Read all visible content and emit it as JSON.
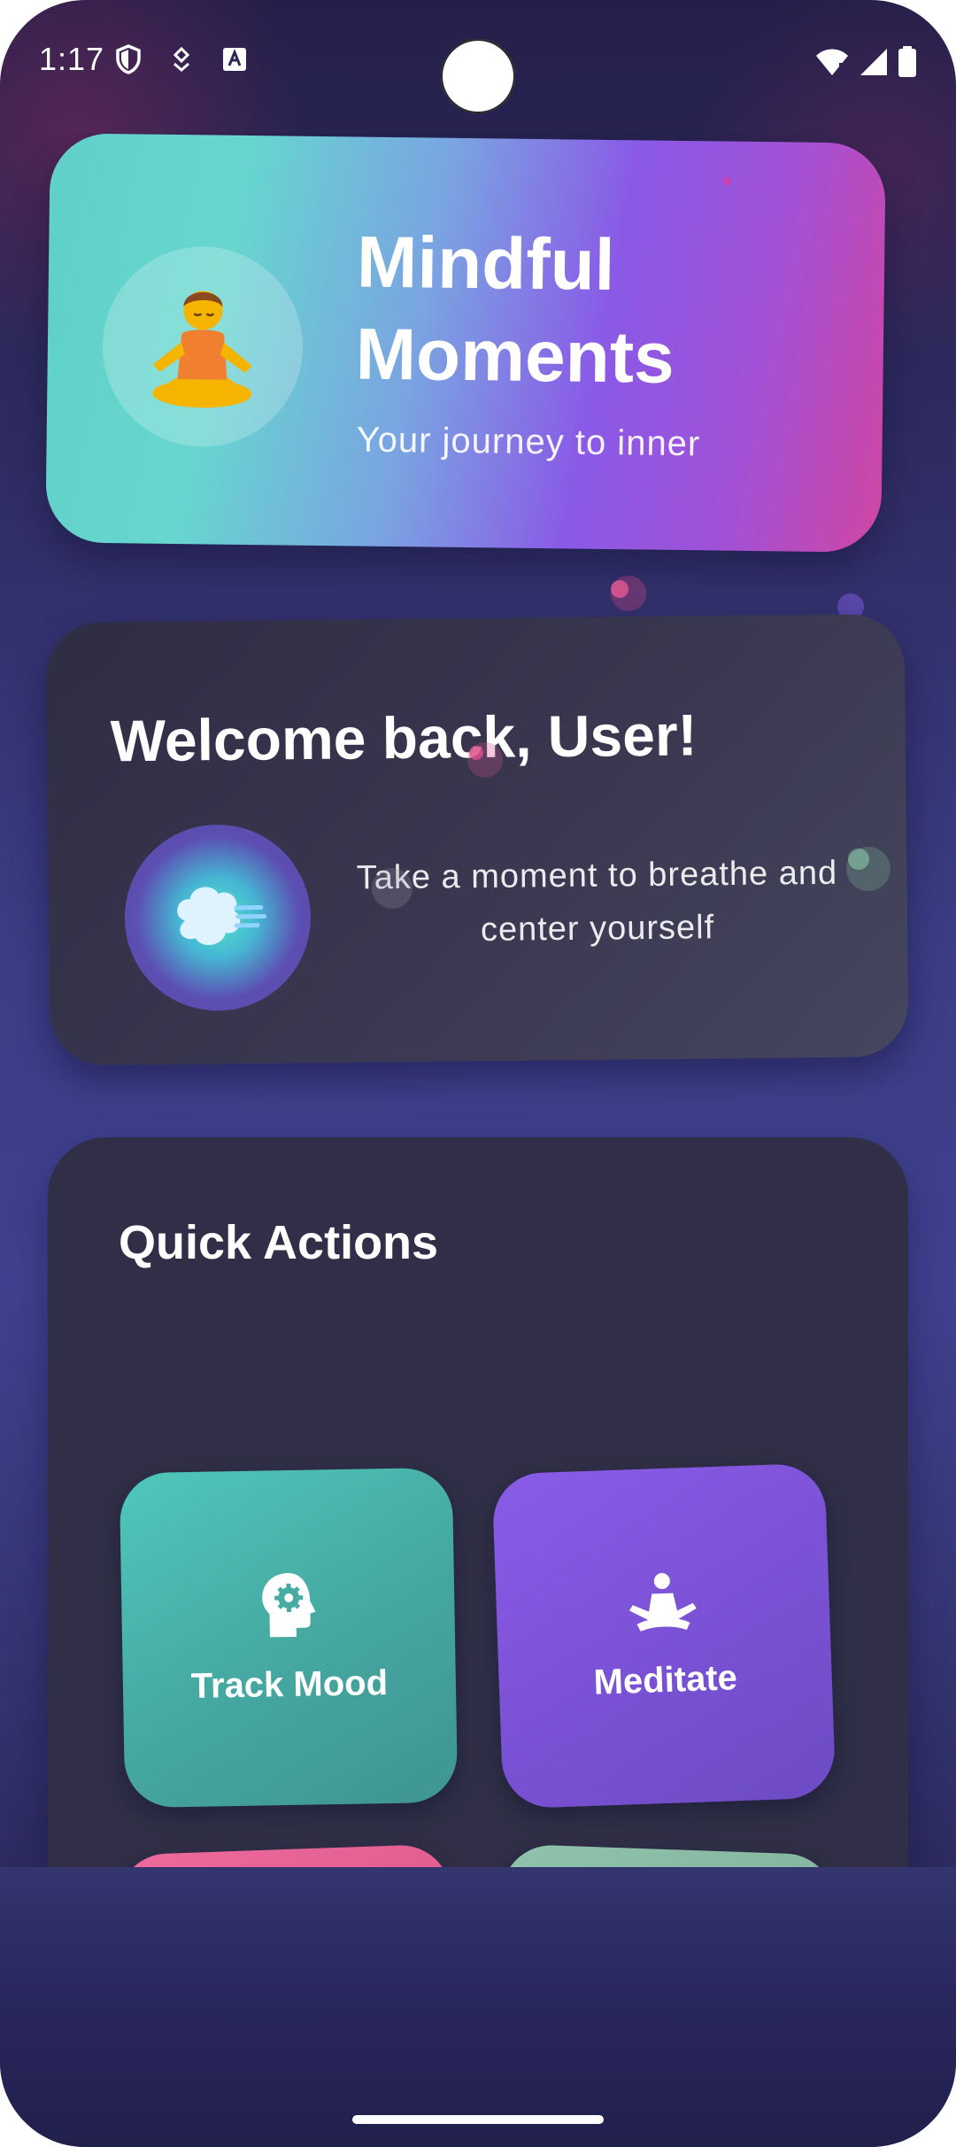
{
  "status_bar": {
    "time": "1:17",
    "icons_left": [
      "shield-icon",
      "location-pin-icon",
      "text-a-icon"
    ],
    "icons_right": [
      "wifi-icon",
      "signal-icon",
      "battery-icon"
    ]
  },
  "hero": {
    "title": "Mindful Moments",
    "subtitle": "Your journey to inner",
    "avatar_emoji": "🧘"
  },
  "welcome": {
    "title": "Welcome back, User!",
    "message": "Take a moment to breathe and center yourself",
    "orb_emoji": "🌬️"
  },
  "quick_actions": {
    "title": "Quick Actions",
    "tiles": [
      {
        "label": "Track Mood",
        "icon": "psychology-head-icon",
        "color": "#4fc7bb"
      },
      {
        "label": "Meditate",
        "icon": "meditation-icon",
        "color": "#8a5ce8"
      },
      {
        "label": "",
        "icon": "wind-icon",
        "color": "#f06a9c"
      },
      {
        "label": "",
        "icon": "insights-chart-icon",
        "color": "#8fc3ad"
      }
    ]
  },
  "colors": {
    "background_top": "#241f4a",
    "background_mid": "#3f4190",
    "card_dark": "#302f47",
    "hero_teal": "#5fd0c7",
    "hero_purple": "#8a5ae6",
    "hero_pink": "#cf46a3"
  }
}
